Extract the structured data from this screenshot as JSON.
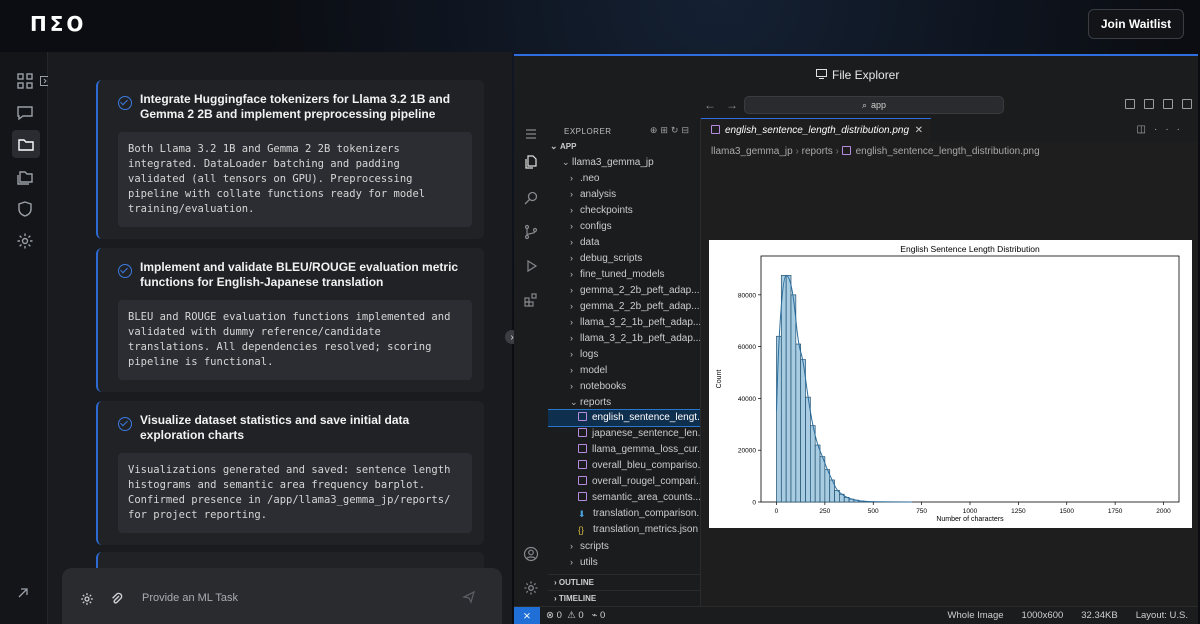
{
  "brand": {
    "logo": "ΠΣΟ",
    "join_label": "Join Waitlist"
  },
  "rail": {
    "icons": [
      "grid-icon",
      "chat-icon",
      "folder-icon",
      "files-icon",
      "shield-icon",
      "gear-icon"
    ]
  },
  "tasks": [
    {
      "title": "Integrate Huggingface tokenizers for Llama 3.2 1B and Gemma 2 2B and implement preprocessing pipeline",
      "body": "Both Llama 3.2 1B and Gemma 2 2B tokenizers integrated. DataLoader batching and padding validated (all tensors on GPU). Preprocessing pipeline with collate functions ready for model training/evaluation."
    },
    {
      "title": "Implement and validate BLEU/ROUGE evaluation metric functions for English-Japanese translation",
      "body": "BLEU and ROUGE evaluation functions implemented and validated with dummy reference/candidate translations. All dependencies resolved; scoring pipeline is functional."
    },
    {
      "title": "Visualize dataset statistics and save initial data exploration charts",
      "body": "Visualizations generated and saved: sentence length histograms and semantic area frequency barplot. Confirmed presence in /app/llama3_gemma_jp/reports/ for project reporting."
    }
  ],
  "composer": {
    "placeholder": "Provide an ML Task"
  },
  "vscode": {
    "window_title": "File Explorer",
    "command_center": "app",
    "explorer_header": "EXPLORER",
    "tree": [
      {
        "label": "APP",
        "depth": 0,
        "kind": "root"
      },
      {
        "label": "llama3_gemma_jp",
        "depth": 1,
        "kind": "open"
      },
      {
        "label": ".neo",
        "depth": 2,
        "kind": "folder"
      },
      {
        "label": "analysis",
        "depth": 2,
        "kind": "folder"
      },
      {
        "label": "checkpoints",
        "depth": 2,
        "kind": "folder"
      },
      {
        "label": "configs",
        "depth": 2,
        "kind": "folder"
      },
      {
        "label": "data",
        "depth": 2,
        "kind": "folder"
      },
      {
        "label": "debug_scripts",
        "depth": 2,
        "kind": "folder"
      },
      {
        "label": "fine_tuned_models",
        "depth": 2,
        "kind": "folder"
      },
      {
        "label": "gemma_2_2b_peft_adap...",
        "depth": 2,
        "kind": "folder"
      },
      {
        "label": "gemma_2_2b_peft_adap...",
        "depth": 2,
        "kind": "folder"
      },
      {
        "label": "llama_3_2_1b_peft_adap...",
        "depth": 2,
        "kind": "folder"
      },
      {
        "label": "llama_3_2_1b_peft_adap...",
        "depth": 2,
        "kind": "folder"
      },
      {
        "label": "logs",
        "depth": 2,
        "kind": "folder"
      },
      {
        "label": "model",
        "depth": 2,
        "kind": "folder"
      },
      {
        "label": "notebooks",
        "depth": 2,
        "kind": "folder"
      },
      {
        "label": "reports",
        "depth": 2,
        "kind": "open"
      },
      {
        "label": "english_sentence_lengt...",
        "depth": 3,
        "kind": "image",
        "selected": true
      },
      {
        "label": "japanese_sentence_len...",
        "depth": 3,
        "kind": "image"
      },
      {
        "label": "llama_gemma_loss_cur...",
        "depth": 3,
        "kind": "image"
      },
      {
        "label": "overall_bleu_compariso...",
        "depth": 3,
        "kind": "image"
      },
      {
        "label": "overall_rougel_compari...",
        "depth": 3,
        "kind": "image"
      },
      {
        "label": "semantic_area_counts....",
        "depth": 3,
        "kind": "image"
      },
      {
        "label": "translation_comparison...",
        "depth": 3,
        "kind": "download"
      },
      {
        "label": "translation_metrics.json",
        "depth": 3,
        "kind": "json"
      },
      {
        "label": "scripts",
        "depth": 2,
        "kind": "folder"
      },
      {
        "label": "utils",
        "depth": 2,
        "kind": "folder"
      }
    ],
    "sections": {
      "outline": "OUTLINE",
      "timeline": "TIMELINE"
    },
    "tab_label": "english_sentence_length_distribution.png",
    "breadcrumbs": [
      "llama3_gemma_jp",
      "reports",
      "english_sentence_length_distribution.png"
    ],
    "status": {
      "errors": "0",
      "warnings": "0",
      "ports": "0",
      "image_mode": "Whole Image",
      "dimensions": "1000x600",
      "filesize": "32.34KB",
      "layout": "Layout: U.S."
    }
  },
  "chart_data": {
    "type": "bar",
    "title": "English Sentence Length Distribution",
    "xlabel": "Number of characters",
    "ylabel": "Count",
    "xlim": [
      -80,
      2080
    ],
    "ylim": [
      0,
      95000
    ],
    "x_ticks": [
      0,
      250,
      500,
      750,
      1000,
      1250,
      1500,
      1750,
      2000
    ],
    "y_ticks": [
      0,
      20000,
      40000,
      60000,
      80000
    ],
    "bin_width": 25,
    "bin_starts": [
      0,
      25,
      50,
      75,
      100,
      125,
      150,
      175,
      200,
      225,
      250,
      275,
      300,
      325,
      350,
      375,
      400,
      425,
      450,
      475
    ],
    "values": [
      64000,
      87500,
      87500,
      80000,
      61000,
      55000,
      40500,
      29500,
      22000,
      17500,
      12500,
      8500,
      4500,
      3000,
      1800,
      1100,
      700,
      400,
      250,
      120
    ],
    "kde_curve": true,
    "bar_color": "#a8cde2",
    "edge_color": "#1f4e6e",
    "line_color": "#2c6e9e"
  }
}
